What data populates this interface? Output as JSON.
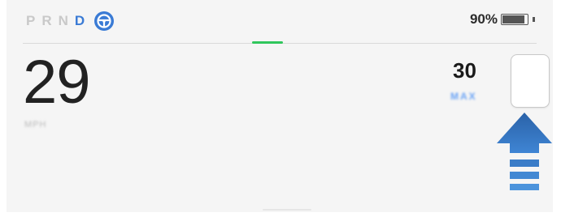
{
  "gears": [
    "P",
    "R",
    "N",
    "D"
  ],
  "active_gear": "D",
  "battery": {
    "percent_label": "90%",
    "level": 0.9
  },
  "speed": {
    "value": "29",
    "unit": "MPH"
  },
  "set_speed": {
    "value": "30",
    "label": "MAX"
  },
  "colors": {
    "accent": "#3a7bd5",
    "autopilot_green": "#30c65c",
    "arrow_blue": "#2f6db5"
  },
  "icons": {
    "steering": "steering-wheel-icon",
    "battery": "battery-icon",
    "arrow": "up-arrow-icon"
  }
}
